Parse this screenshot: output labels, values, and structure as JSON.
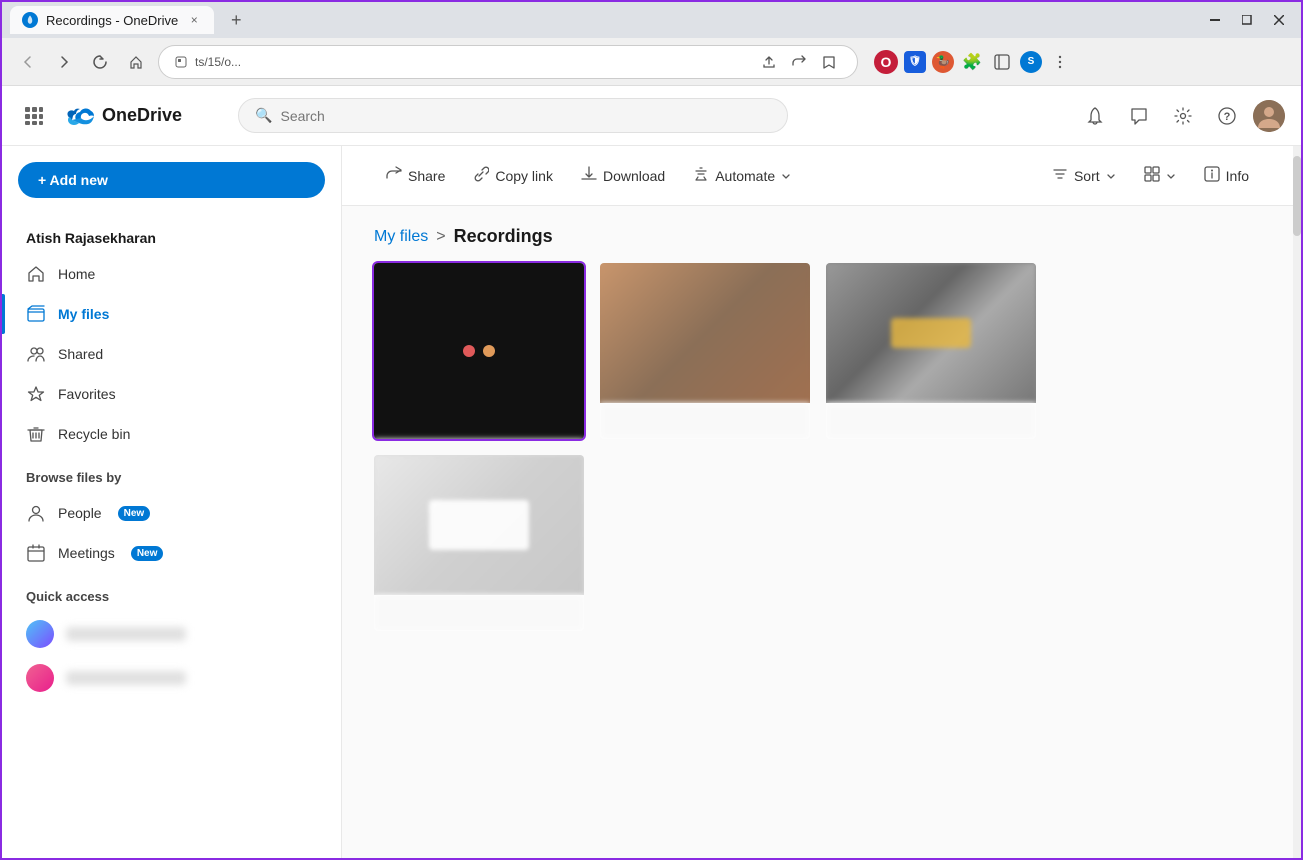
{
  "browser": {
    "tab_title": "Recordings - OneDrive",
    "tab_close": "×",
    "tab_add": "+",
    "address_text": "ts/15/o...",
    "win_minimize": "−",
    "win_restore": "▭",
    "win_close": "×"
  },
  "header": {
    "logo_text": "OneDrive",
    "search_placeholder": "Search"
  },
  "toolbar": {
    "share_label": "Share",
    "copy_link_label": "Copy link",
    "download_label": "Download",
    "automate_label": "Automate",
    "sort_label": "Sort",
    "view_label": "",
    "info_label": "Info"
  },
  "breadcrumb": {
    "parent": "My files",
    "separator": ">",
    "current": "Recordings"
  },
  "sidebar": {
    "user_name": "Atish Rajasekharan",
    "add_new_label": "+ Add new",
    "nav_items": [
      {
        "icon": "🏠",
        "label": "Home",
        "active": false
      },
      {
        "icon": "📁",
        "label": "My files",
        "active": true
      },
      {
        "icon": "👥",
        "label": "Shared",
        "active": false
      },
      {
        "icon": "☆",
        "label": "Favorites",
        "active": false
      },
      {
        "icon": "🗑",
        "label": "Recycle bin",
        "active": false
      }
    ],
    "browse_section": "Browse files by",
    "browse_items": [
      {
        "icon": "👤",
        "label": "People",
        "badge": "New"
      },
      {
        "icon": "📅",
        "label": "Meetings",
        "badge": "New"
      }
    ],
    "quick_access_section": "Quick access"
  },
  "files": {
    "selected_index": 0,
    "items": [
      {
        "type": "dark",
        "label": ""
      },
      {
        "type": "blurred_warm",
        "label": ""
      },
      {
        "type": "blurred_gray",
        "label": ""
      },
      {
        "type": "blurred_white",
        "label": ""
      }
    ]
  }
}
